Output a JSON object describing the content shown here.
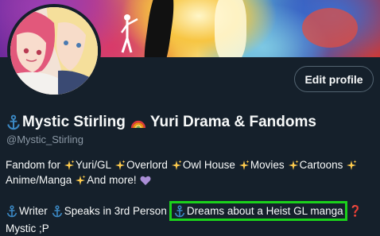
{
  "profile": {
    "display_name": "Mystic Stirling",
    "name_suffix": "Yuri Drama & Fandoms",
    "handle": "@Mystic_Stirling",
    "edit_button": "Edit profile"
  },
  "bio": {
    "line1": [
      "Fandom for",
      "Yuri/GL",
      "Overlord",
      "Owl House",
      "Movies",
      "Cartoons"
    ],
    "line2": [
      "Anime/Manga",
      "And more!"
    ],
    "line3": [
      "Writer",
      "Speaks in 3rd Person"
    ],
    "highlighted": "Dreams about a Heist GL manga",
    "line4": "Mystic ;P"
  },
  "colors": {
    "background": "#15202b",
    "secondary_text": "#8b98a5",
    "highlight_border": "#1bd11b",
    "anchor_blue": "#3b88c3"
  },
  "icons": [
    "anchor-icon",
    "rainbow-icon",
    "sparkles-icon",
    "purple-heart-icon",
    "question-mark-icon"
  ]
}
